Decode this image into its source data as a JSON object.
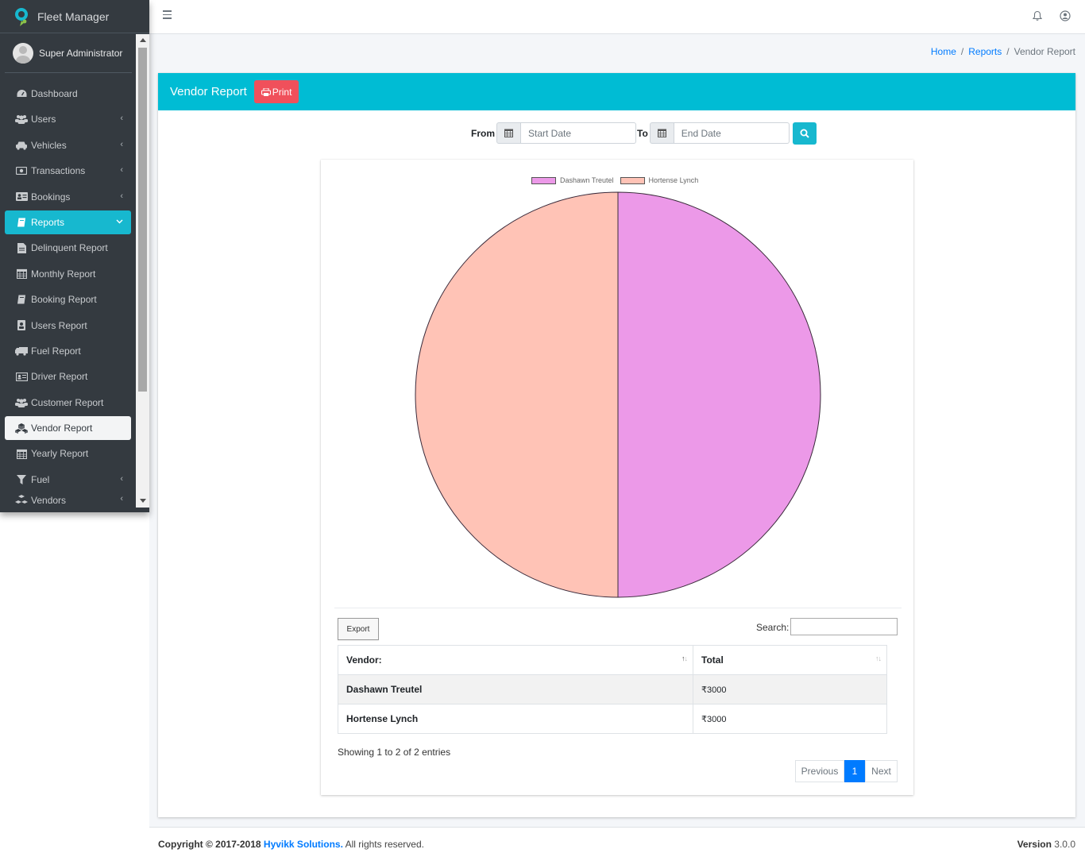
{
  "app": {
    "title": "Fleet Manager"
  },
  "user": {
    "name": "Super Administrator"
  },
  "sidebar": {
    "items": [
      {
        "label": "Dashboard",
        "icon": "dashboard-icon"
      },
      {
        "label": "Users",
        "icon": "users-icon"
      },
      {
        "label": "Vehicles",
        "icon": "car-icon"
      },
      {
        "label": "Transactions",
        "icon": "money-icon"
      },
      {
        "label": "Bookings",
        "icon": "address-card-icon"
      },
      {
        "label": "Reports",
        "icon": "book-icon"
      },
      {
        "label": "Delinquent Report",
        "icon": "file-icon"
      },
      {
        "label": "Monthly Report",
        "icon": "calendar-icon"
      },
      {
        "label": "Booking Report",
        "icon": "book-icon"
      },
      {
        "label": "Users Report",
        "icon": "address-book-icon"
      },
      {
        "label": "Fuel Report",
        "icon": "truck-icon"
      },
      {
        "label": "Driver Report",
        "icon": "id-card-icon"
      },
      {
        "label": "Customer Report",
        "icon": "users-icon"
      },
      {
        "label": "Vendor Report",
        "icon": "cubes-icon"
      },
      {
        "label": "Yearly Report",
        "icon": "calendar-icon"
      },
      {
        "label": "Fuel",
        "icon": "filter-icon"
      },
      {
        "label": "Vendors",
        "icon": "cubes-icon"
      }
    ]
  },
  "breadcrumb": {
    "home": "Home",
    "reports": "Reports",
    "current": "Vendor Report",
    "separator": "/"
  },
  "card": {
    "title": "Vendor Report",
    "print_label": "Print"
  },
  "filter": {
    "from_label": "From",
    "to_label": "To",
    "start_placeholder": "Start Date",
    "end_placeholder": "End Date"
  },
  "chart_data": {
    "type": "pie",
    "categories": [
      "Dashawn Treutel",
      "Hortense Lynch"
    ],
    "values": [
      3000,
      3000
    ],
    "colors": [
      "#ec99e8",
      "#ffc3b6"
    ],
    "legend": "top"
  },
  "table": {
    "export_label": "Export",
    "search_label": "Search:",
    "headers": {
      "vendor": "Vendor:",
      "total": "Total"
    },
    "rows": [
      {
        "vendor": "Dashawn Treutel",
        "total": "₹3000"
      },
      {
        "vendor": "Hortense Lynch",
        "total": "₹3000"
      }
    ],
    "info": "Showing 1 to 2 of 2 entries",
    "pagination": {
      "previous": "Previous",
      "page": "1",
      "next": "Next"
    }
  },
  "footer": {
    "copyright": "Copyright © 2017-2018",
    "company": "Hyvikk Solutions.",
    "rights": "All rights reserved.",
    "version_label": "Version",
    "version": "3.0.0"
  },
  "colors": {
    "accent": "#00bcd4",
    "print": "#f0505b",
    "sidebar": "#343a40",
    "link": "#007bff"
  }
}
